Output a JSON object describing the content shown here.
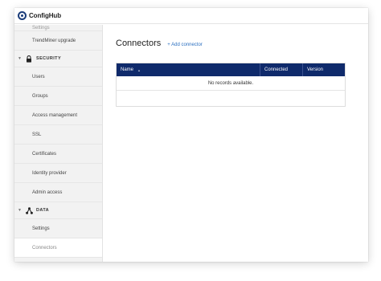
{
  "app": {
    "name": "ConfigHub"
  },
  "sidebar": {
    "cut_item": "Settings",
    "items_top": [
      "TrendMiner upgrade"
    ],
    "sections": [
      {
        "label": "SECURITY",
        "icon": "lock-icon",
        "items": [
          "Users",
          "Groups",
          "Access management",
          "SSL",
          "Certificates",
          "Identity provider",
          "Admin access"
        ]
      },
      {
        "label": "DATA",
        "icon": "network-icon",
        "items": [
          "Settings",
          "Connectors"
        ]
      }
    ],
    "active_item": "Connectors"
  },
  "main": {
    "title": "Connectors",
    "add_link": "+ Add connector",
    "table": {
      "columns": [
        "Name",
        "Connected",
        "Version"
      ],
      "empty_message": "No records available."
    }
  },
  "colors": {
    "table_header": "#0f2a6b",
    "link": "#2a6fc0",
    "sidebar_bg": "#f2f2f2"
  }
}
